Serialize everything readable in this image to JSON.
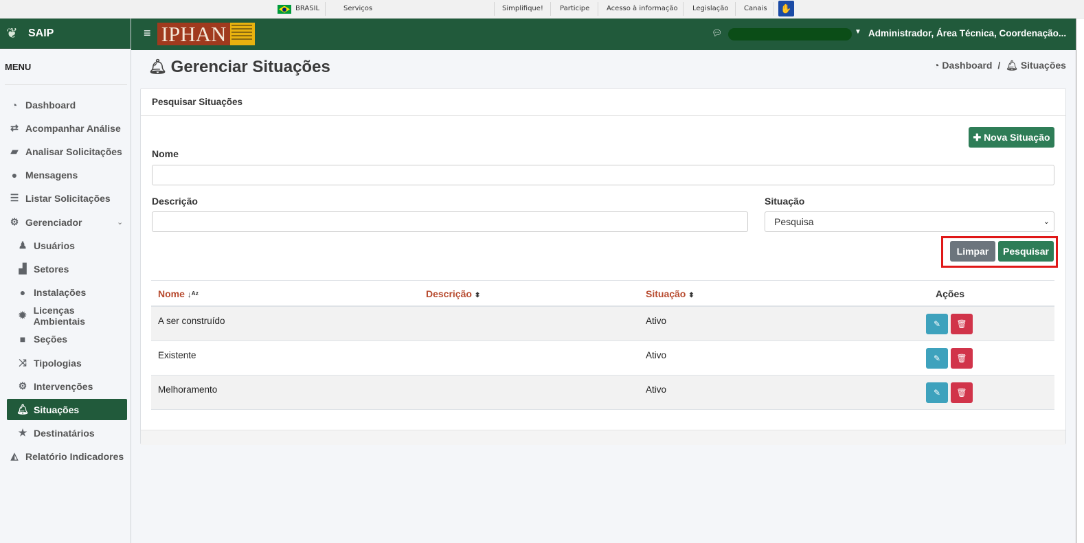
{
  "gov_bar": {
    "country": "BRASIL",
    "services": "Serviços",
    "links": [
      "Simplifique!",
      "Participe",
      "Acesso à informação",
      "Legislação",
      "Canais"
    ]
  },
  "sidebar": {
    "brand": "SAIP",
    "menu_label": "MENU",
    "items": [
      {
        "label": "Dashboard",
        "icon": "dashboard-icon"
      },
      {
        "label": "Acompanhar Análise",
        "icon": "exchange-icon"
      },
      {
        "label": "Analisar Solicitações",
        "icon": "book-icon"
      },
      {
        "label": "Mensagens",
        "icon": "comments-icon"
      },
      {
        "label": "Listar Solicitações",
        "icon": "list-icon"
      },
      {
        "label": "Gerenciador",
        "icon": "cogs-icon"
      },
      {
        "label": "Usuários",
        "icon": "users-icon"
      },
      {
        "label": "Setores",
        "icon": "chart-icon"
      },
      {
        "label": "Instalações",
        "icon": "circle-icon"
      },
      {
        "label": "Licenças Ambientais",
        "icon": "certificate-icon"
      },
      {
        "label": "Seções",
        "icon": "square-icon"
      },
      {
        "label": "Tipologias",
        "icon": "random-icon"
      },
      {
        "label": "Intervenções",
        "icon": "gear-icon"
      },
      {
        "label": "Situações",
        "icon": "bell-icon",
        "active": true
      },
      {
        "label": "Destinatários",
        "icon": "star-icon"
      },
      {
        "label": "Relatório Indicadores",
        "icon": "area-chart-icon"
      }
    ]
  },
  "header": {
    "logo_text": "IPHAN",
    "user": "Administrador, Área Técnica, Coordenação..."
  },
  "page": {
    "title": "Gerenciar Situações",
    "breadcrumb": [
      "Dashboard",
      "/",
      "Situações"
    ]
  },
  "search": {
    "card_title": "Pesquisar Situações",
    "new_button": "Nova Situação",
    "nome_label": "Nome",
    "nome_value": "",
    "descricao_label": "Descrição",
    "descricao_value": "",
    "situacao_label": "Situação",
    "situacao_selected": "Pesquisa",
    "clear_button": "Limpar",
    "search_button": "Pesquisar"
  },
  "table": {
    "columns": [
      "Nome",
      "Descrição",
      "Situação",
      "Ações"
    ],
    "rows": [
      {
        "nome": "A ser construído",
        "descricao": "",
        "situacao": "Ativo"
      },
      {
        "nome": "Existente",
        "descricao": "",
        "situacao": "Ativo"
      },
      {
        "nome": "Melhoramento",
        "descricao": "",
        "situacao": "Ativo"
      }
    ]
  },
  "colors": {
    "brand_green": "#215a3b",
    "button_green": "#2e7d57",
    "sort_header": "#b74a2e",
    "edit_button": "#3ea2bd",
    "delete_button": "#d1344a",
    "highlight": "#e01818"
  }
}
